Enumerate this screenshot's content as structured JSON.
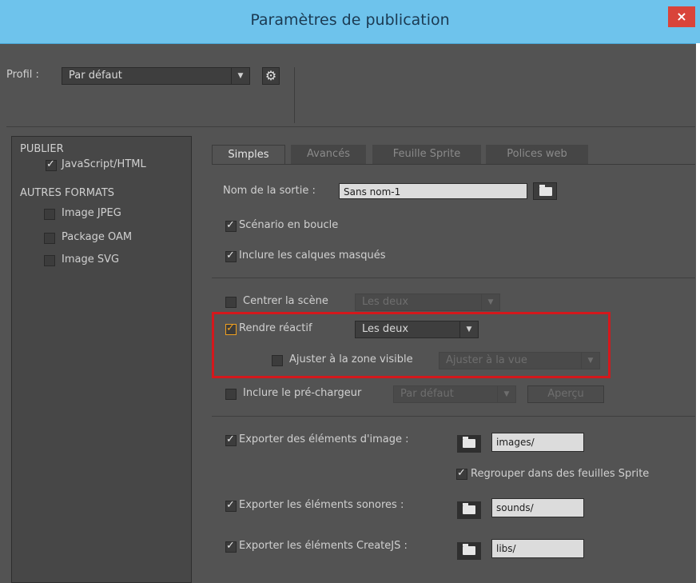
{
  "window": {
    "title": "Paramètres de publication",
    "close_label": "×"
  },
  "profile": {
    "label": "Profil :",
    "value": "Par défaut"
  },
  "left_panel": {
    "section_publish": "PUBLIER",
    "publish_items": [
      {
        "label": "JavaScript/HTML",
        "checked": true
      }
    ],
    "section_other": "AUTRES FORMATS",
    "other_items": [
      {
        "label": "Image JPEG",
        "checked": false
      },
      {
        "label": "Package OAM",
        "checked": false
      },
      {
        "label": "Image SVG",
        "checked": false
      }
    ]
  },
  "tabs": [
    {
      "label": "Simples",
      "active": true
    },
    {
      "label": "Avancés",
      "active": false
    },
    {
      "label": "Feuille Sprite",
      "active": false
    },
    {
      "label": "Polices web",
      "active": false
    }
  ],
  "basic": {
    "output_name_label": "Nom de la sortie :",
    "output_name_value": "Sans nom-1",
    "loop_timeline": "Scénario en boucle",
    "include_hidden_layers": "Inclure les calques masqués",
    "center_stage": "Centrer la scène",
    "center_stage_option": "Les deux",
    "make_responsive": "Rendre réactif",
    "make_responsive_option": "Les deux",
    "scale_to_fill": "Ajuster à la zone visible",
    "scale_to_fill_option": "Ajuster à la vue",
    "include_preloader": "Inclure le pré-chargeur",
    "preloader_option": "Par défaut",
    "preview_button": "Aperçu",
    "export_images_label": "Exporter des éléments d'image :",
    "export_images_path": "images/",
    "pack_sprite": "Regrouper dans des feuilles Sprite",
    "export_sounds_label": "Exporter les éléments sonores :",
    "export_sounds_path": "sounds/",
    "export_createjs_label": "Exporter les éléments CreateJS :",
    "export_createjs_path": "libs/"
  },
  "colors": {
    "title_bar": "#6ec3ec",
    "dialog_bg": "#535353",
    "highlight": "#d4181c",
    "accent_check": "#f0a020"
  }
}
